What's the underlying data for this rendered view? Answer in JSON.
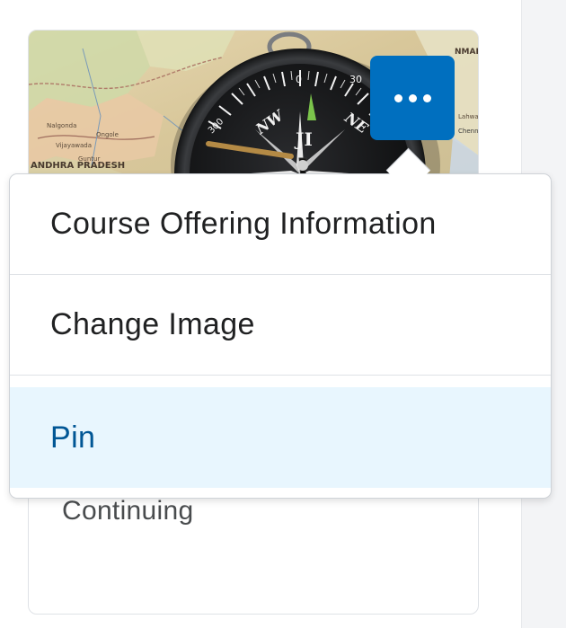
{
  "course_card": {
    "image_alt": "Compass on map",
    "map_labels": {
      "state": "ANDHRA PRADESH",
      "region_top_right": "NMAR",
      "city_right": "Chenn"
    },
    "compass_marks": {
      "zero": "0",
      "thirty": "30",
      "three_hundred": "300",
      "ne": "NE",
      "nw": "NW"
    },
    "body_text": "Continuing"
  },
  "more_button": {
    "icon": "more-horizontal-icon",
    "aria_label": "Open course options",
    "color": "#006fbf"
  },
  "menu": {
    "items": [
      {
        "label": "Course Offering Information"
      },
      {
        "label": "Change Image"
      },
      {
        "label": "Pin"
      }
    ],
    "highlight_color": "#e8f6fe",
    "highlight_text_color": "#005695"
  }
}
